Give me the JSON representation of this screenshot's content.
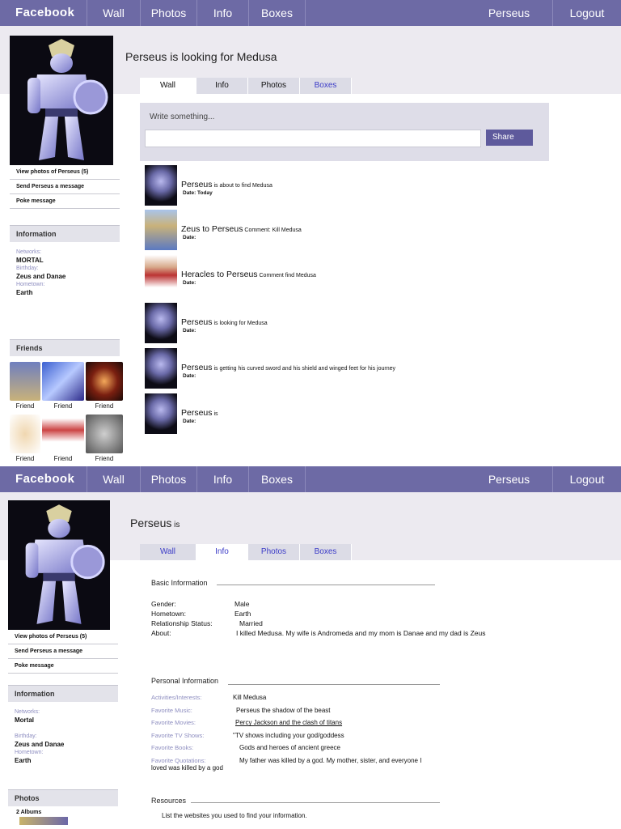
{
  "nav": {
    "brand": "Facebook",
    "wall": "Wall",
    "photos": "Photos",
    "info": "Info",
    "boxes": "Boxes",
    "user": "Perseus",
    "logout": "Logout"
  },
  "sidebar": {
    "view_photos": "View photos of Perseus (5)",
    "view_photos_b": "View photos of Perseus  (5)",
    "send_message": "Send Perseus a message",
    "poke": "Poke message",
    "information": "Information",
    "networks_label": "Networks:",
    "networks_a": "MORTAL",
    "networks_b": "Mortal",
    "birthday_label": "Birthday:",
    "birthday_val": "Zeus and Danae",
    "hometown_label": "Hometown:",
    "hometown_val": "Earth",
    "friends": "Friends",
    "friend_label": "Friend",
    "photos": "Photos",
    "albums": "2 Albums"
  },
  "wall_page": {
    "title": "Perseus is looking for Medusa",
    "tabs": [
      "Wall",
      "Info",
      "Photos",
      "Boxes"
    ],
    "composer_hint": "Write something...",
    "share": "Share",
    "posts": [
      {
        "name": "Perseus",
        "msg": " is about to find Medusa",
        "date": "Date: Today",
        "avatar": "perseus"
      },
      {
        "name": "Zeus to Perseus",
        "msg": " Comment: Kill Medusa",
        "date": "Date:",
        "avatar": "zeus"
      },
      {
        "name": "Heracles to Perseus",
        "msg": " Comment find Medusa",
        "date": "Date:",
        "avatar": "heracles"
      },
      {
        "name": "Perseus",
        "msg": " is looking for Medusa",
        "date": "Date:",
        "avatar": "perseus"
      },
      {
        "name": "Perseus",
        "msg": "  is getting his curved sword and his shield and winged feet for his journey",
        "date": "Date:",
        "avatar": "perseus"
      },
      {
        "name": "Perseus",
        "msg": " is",
        "date": "Date:",
        "avatar": "perseus"
      }
    ]
  },
  "info_page": {
    "title_name": "Perseus",
    "title_rest": " is",
    "tabs": [
      "Wall",
      "Info",
      "Photos",
      "Boxes"
    ],
    "basic_title": "Basic Information",
    "gender_k": "Gender:",
    "gender_v": "Male",
    "hometown_k": "Hometown:",
    "hometown_v": "Earth",
    "relationship_k": "Relationship Status:",
    "relationship_v": "Married",
    "about_k": "About:",
    "about_v": "I killed Medusa. My wife is Andromeda and my mom is Danae and my dad is Zeus",
    "personal_title": "Personal Information",
    "activities_k": "Activities/Interests:",
    "activities_v": "Kill Medusa",
    "music_k": "Favorite Music:",
    "music_v": "Perseus the shadow of the beast",
    "movies_k": "Favorite Movies:",
    "movies_v": "Percy Jackson and the clash of titans",
    "tv_k": "Favorite TV Shows:",
    "tv_v": "\"TV shows including your god/goddess",
    "books_k": "Favorite Books:",
    "books_v": "Gods and heroes of ancient greece",
    "quotes_k": "Favorite Quotations:",
    "quotes_v": "My father was killed by a god. My mother, sister, and everyone I",
    "quotes_v2": "loved was killed by a god",
    "resources_title": "Resources",
    "resources_text": "List the websites you used to find your information."
  }
}
